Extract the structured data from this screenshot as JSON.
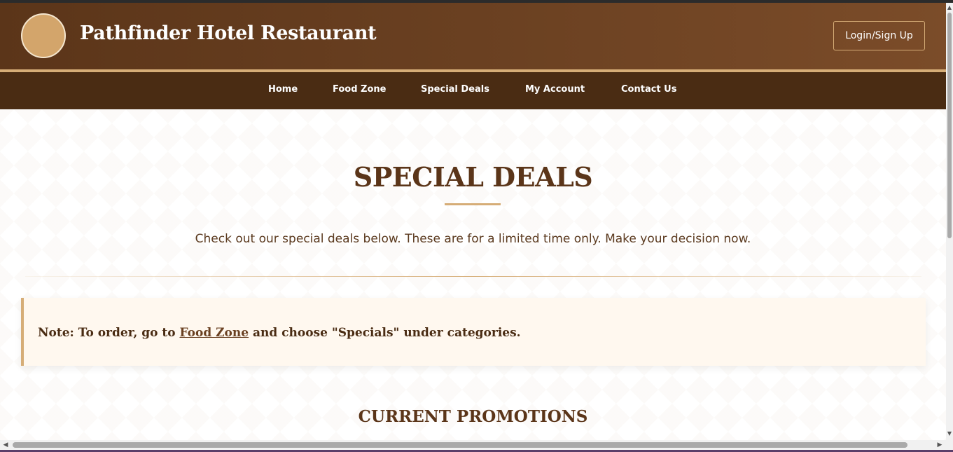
{
  "header": {
    "brand": "Pathfinder Hotel Restaurant",
    "login_label": "Login/Sign Up"
  },
  "nav": {
    "items": [
      {
        "label": "Home"
      },
      {
        "label": "Food Zone"
      },
      {
        "label": "Special Deals"
      },
      {
        "label": "My Account"
      },
      {
        "label": "Contact Us"
      }
    ]
  },
  "main": {
    "title": "SPECIAL DEALS",
    "intro": "Check out our special deals below. These are for a limited time only. Make your decision now.",
    "note": {
      "prefix": "Note: To order, go to ",
      "link": "Food Zone",
      "suffix": " and choose \"Specials\" under categories."
    },
    "section_heading": "CURRENT PROMOTIONS"
  },
  "icons": {
    "logo": "logo-circle",
    "scroll_up": "arrow-up-icon",
    "scroll_down": "arrow-down-icon",
    "scroll_left": "arrow-left-icon",
    "scroll_right": "arrow-right-icon"
  },
  "colors": {
    "header_brown": "#6a4021",
    "nav_brown": "#4a2c13",
    "accent_gold": "#d6ad77",
    "note_background": "#fff8ef",
    "text_brown": "#5b3519"
  }
}
